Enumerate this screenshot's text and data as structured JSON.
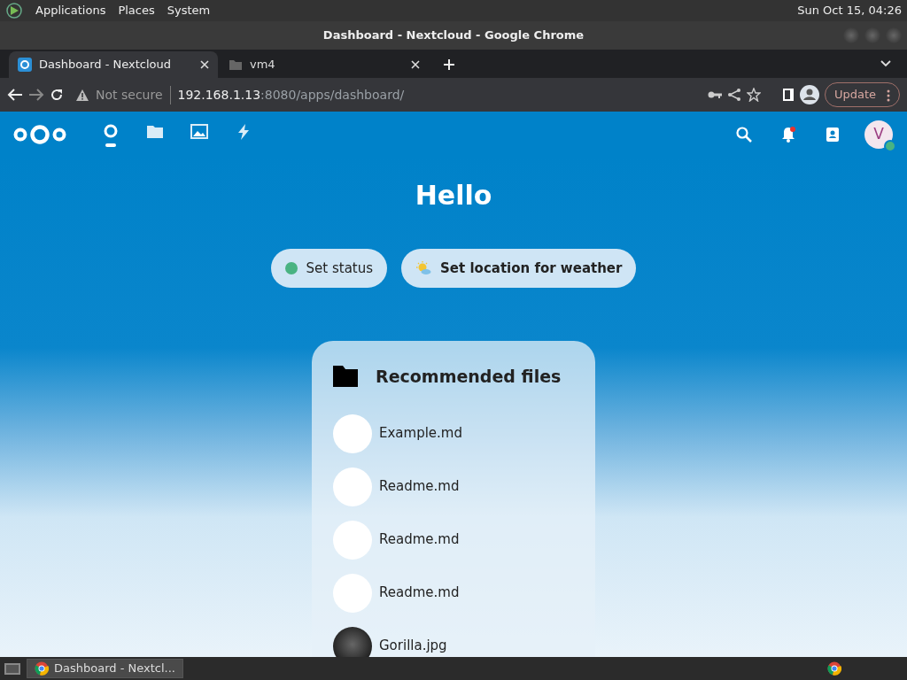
{
  "top_panel": {
    "menus": [
      "Applications",
      "Places",
      "System"
    ],
    "clock": "Sun Oct 15, 04:26"
  },
  "window": {
    "title": "Dashboard - Nextcloud - Google Chrome"
  },
  "tabs": [
    {
      "label": "Dashboard - Nextcloud",
      "kind": "nextcloud",
      "selected": true
    },
    {
      "label": "vm4",
      "kind": "folder",
      "selected": false
    }
  ],
  "address_bar": {
    "security": "Not secure",
    "url_host": "192.168.1.13",
    "url_path": ":8080/apps/dashboard/",
    "update_label": "Update"
  },
  "app_nav": [
    {
      "kind": "dashboard",
      "selected": true
    },
    {
      "kind": "files",
      "selected": false
    },
    {
      "kind": "photos",
      "selected": false
    },
    {
      "kind": "activity",
      "selected": false
    }
  ],
  "header_right": {
    "notifications_unread": true,
    "avatar_letter": "V",
    "online": true
  },
  "greeting": "Hello",
  "actions": [
    {
      "kind": "status",
      "label": "Set status",
      "bold": false
    },
    {
      "kind": "weather",
      "label": "Set location for weather",
      "bold": true
    }
  ],
  "widget": {
    "title": "Recommended files",
    "files": [
      {
        "name": "Example.md",
        "kind": "document"
      },
      {
        "name": "Readme.md",
        "kind": "document"
      },
      {
        "name": "Readme.md",
        "kind": "document"
      },
      {
        "name": "Readme.md",
        "kind": "document"
      },
      {
        "name": "Gorilla.jpg",
        "kind": "photo"
      }
    ]
  },
  "taskbar": {
    "items": [
      {
        "label": "Dashboard - Nextcl...",
        "selected": true
      }
    ]
  }
}
